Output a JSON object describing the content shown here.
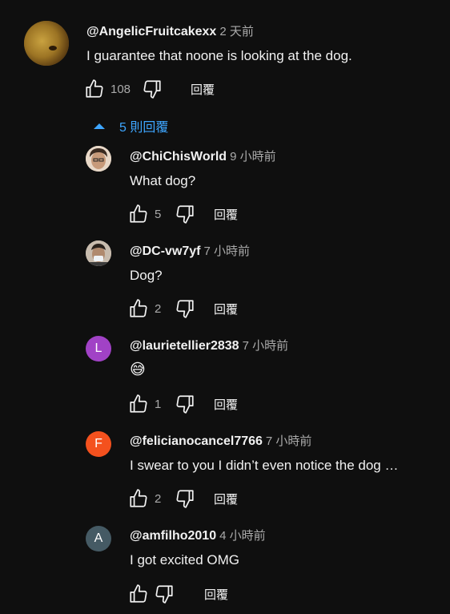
{
  "top_comment": {
    "author": "@AngelicFruitcakexx",
    "time": "2 天前",
    "text": "I guarantee that noone is looking at the dog.",
    "likes": "108",
    "reply_label": "回覆"
  },
  "replies_toggle": {
    "label": "5 則回覆",
    "color": "#3ea6ff"
  },
  "replies": [
    {
      "author": "@ChiChisWorld",
      "time": "9 小時前",
      "text": "What dog?",
      "likes": "5",
      "reply_label": "回覆"
    },
    {
      "author": "@DC-vw7yf",
      "time": "7 小時前",
      "text": "Dog?",
      "likes": "2",
      "reply_label": "回覆"
    },
    {
      "author": "@laurietellier2838",
      "time": "7 小時前",
      "text": "😅",
      "likes": "1",
      "reply_label": "回覆",
      "avatar_letter": "L",
      "avatar_color": "#a142c6"
    },
    {
      "author": "@felicianocancel7766",
      "time": "7 小時前",
      "text": "I swear to you I didn’t even notice the dog …",
      "likes": "2",
      "reply_label": "回覆",
      "avatar_letter": "F",
      "avatar_color": "#f4511e"
    },
    {
      "author": "@amfilho2010",
      "time": "4 小時前",
      "text": "I got excited OMG",
      "likes": "",
      "reply_label": "回覆",
      "avatar_letter": "A",
      "avatar_color": "#455a64"
    }
  ],
  "icons": {
    "like": "thumbs-up-icon",
    "dislike": "thumbs-down-icon",
    "collapse": "caret-up-icon"
  }
}
